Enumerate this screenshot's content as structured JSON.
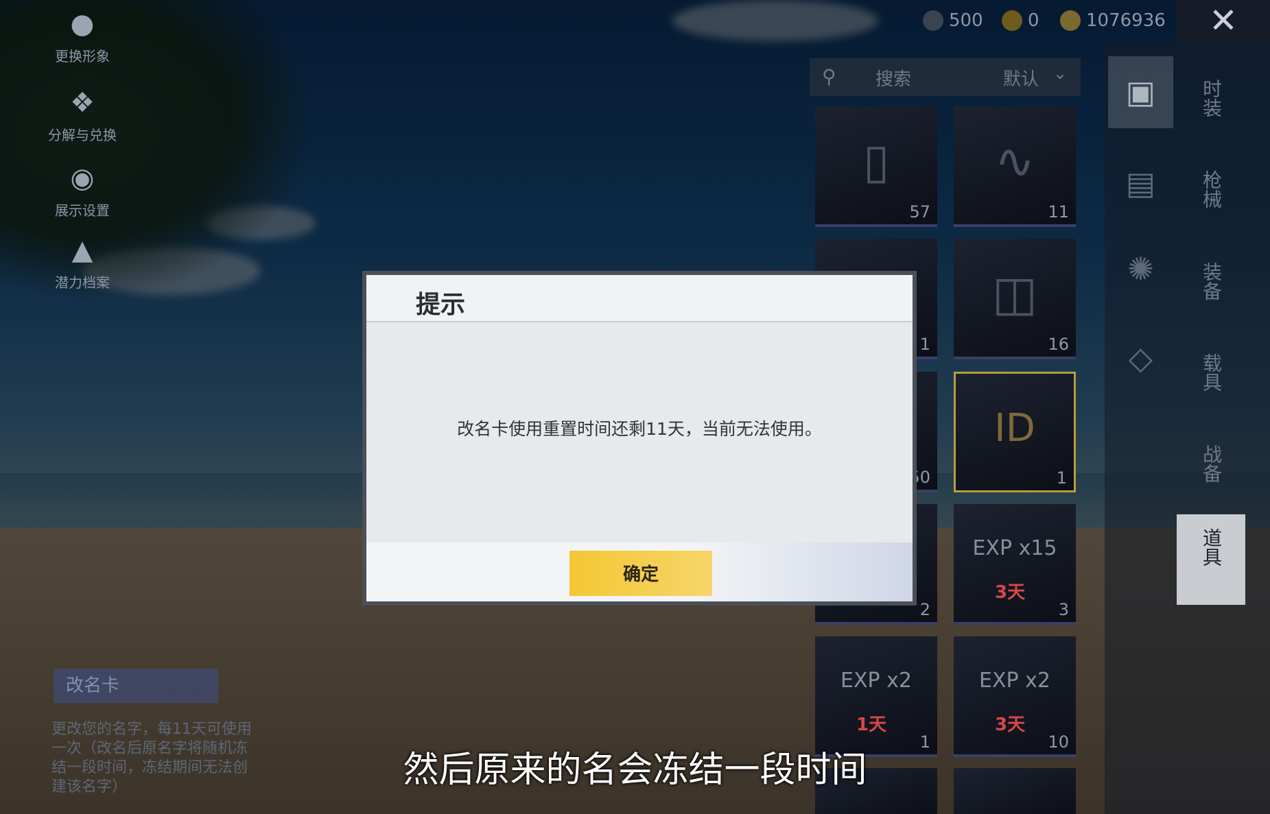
{
  "left_menu": [
    {
      "label": "更换形象",
      "icon": "person-icon"
    },
    {
      "label": "分解与兑换",
      "icon": "puzzle-icon"
    },
    {
      "label": "展示设置",
      "icon": "eye-icon"
    },
    {
      "label": "潜力档案",
      "icon": "flame-icon"
    }
  ],
  "currency": {
    "a": "500",
    "b": "0",
    "c": "1076936"
  },
  "search": {
    "label": "搜索",
    "sort": "默认"
  },
  "categories": [
    "时装",
    "枪械",
    "装备",
    "载具",
    "战备",
    "道具"
  ],
  "inventory": {
    "counts": [
      "57",
      "11",
      "1",
      "16",
      "50",
      "1",
      "2",
      "3",
      "1",
      "10"
    ],
    "badges": [
      "3天",
      "1天",
      "3天"
    ],
    "multipliers": [
      "x15",
      "x2",
      "x2"
    ]
  },
  "detail": {
    "name": "改名卡",
    "desc": "更改您的名字，每11天可使用一次（改名后原名字将随机冻结一段时间，冻结期间无法创建该名字）"
  },
  "dialog": {
    "title": "提示",
    "message": "改名卡使用重置时间还剩11天，当前无法使用。",
    "confirm": "确定"
  },
  "subtitle": "然后原来的名会冻结一段时间",
  "colors": {
    "accent": "#f4c733",
    "selected_border": "#b89d3e"
  }
}
